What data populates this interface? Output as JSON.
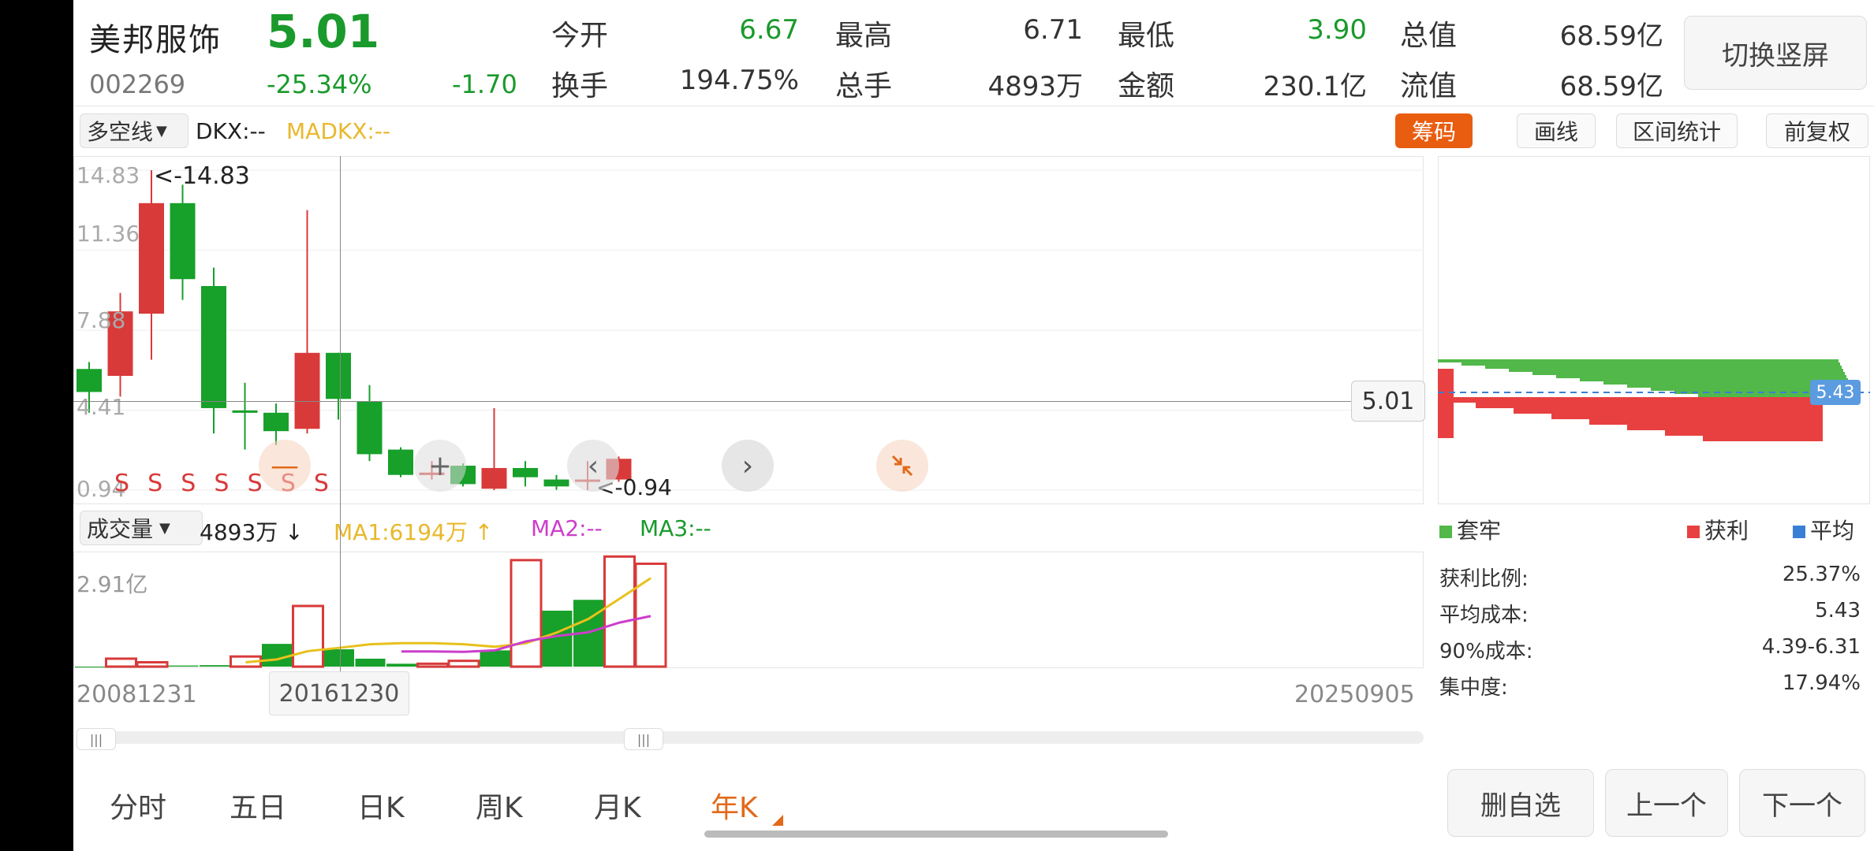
{
  "stock": {
    "name": "美邦服饰",
    "price": "5.01",
    "code": "002269",
    "change_pct": "-25.34%",
    "change": "-1.70"
  },
  "quote": [
    {
      "label": "今开",
      "value": "6.67",
      "color": "green"
    },
    {
      "label": "最高",
      "value": "6.71",
      "color": "dark"
    },
    {
      "label": "最低",
      "value": "3.90",
      "color": "green"
    },
    {
      "label": "总值",
      "value": "68.59亿",
      "color": "dark"
    },
    {
      "label": "换手",
      "value": "194.75%",
      "color": "dark"
    },
    {
      "label": "总手",
      "value": "4893万",
      "color": "dark"
    },
    {
      "label": "金额",
      "value": "230.1亿",
      "color": "dark"
    },
    {
      "label": "流值",
      "value": "68.59亿",
      "color": "dark"
    }
  ],
  "switch_screen_label": "切换竖屏",
  "toolbar": {
    "indicator_select": "多空线",
    "dkx": "DKX:--",
    "madkx": "MADKX:--",
    "buttons": [
      "筹码",
      "画线",
      "区间统计",
      "前复权"
    ],
    "active_button": "筹码"
  },
  "kline": {
    "y_labels": [
      "14.83",
      "11.36",
      "7.88",
      "4.41",
      "0.94"
    ],
    "max_marker": "<-14.83",
    "min_marker": "<-0.94",
    "current_price_tag": "5.01",
    "signal_marks": [
      "S",
      "S",
      "S",
      "S",
      "S",
      "S",
      "S"
    ],
    "ylim": [
      0.94,
      14.83
    ],
    "candles": [
      {
        "o": 5.2,
        "c": 6.2,
        "h": 6.5,
        "l": 4.3,
        "up": false
      },
      {
        "o": 5.9,
        "c": 8.7,
        "h": 9.5,
        "l": 5.0,
        "up": true
      },
      {
        "o": 8.6,
        "c": 13.4,
        "h": 14.83,
        "l": 6.6,
        "up": true
      },
      {
        "o": 13.4,
        "c": 10.1,
        "h": 14.2,
        "l": 9.2,
        "up": false
      },
      {
        "o": 9.8,
        "c": 4.5,
        "h": 10.6,
        "l": 3.4,
        "up": false
      },
      {
        "o": 4.4,
        "c": 4.4,
        "h": 5.6,
        "l": 2.7,
        "up": false
      },
      {
        "o": 4.3,
        "c": 3.5,
        "h": 4.7,
        "l": 2.9,
        "up": false
      },
      {
        "o": 3.6,
        "c": 6.9,
        "h": 13.1,
        "l": 3.4,
        "up": true
      },
      {
        "o": 6.9,
        "c": 4.9,
        "h": 6.9,
        "l": 4.0,
        "up": false
      },
      {
        "o": 4.8,
        "c": 2.5,
        "h": 5.5,
        "l": 2.2,
        "up": false
      },
      {
        "o": 2.7,
        "c": 1.6,
        "h": 2.8,
        "l": 1.5,
        "up": false
      },
      {
        "o": 1.7,
        "c": 1.7,
        "h": 2.2,
        "l": 1.4,
        "up": true
      },
      {
        "o": 2.0,
        "c": 1.2,
        "h": 2.1,
        "l": 1.1,
        "up": false
      },
      {
        "o": 1.0,
        "c": 1.9,
        "h": 4.5,
        "l": 0.94,
        "up": true
      },
      {
        "o": 1.9,
        "c": 1.5,
        "h": 2.2,
        "l": 1.1,
        "up": false
      },
      {
        "o": 1.4,
        "c": 1.1,
        "h": 1.6,
        "l": 0.95,
        "up": false
      },
      {
        "o": 1.4,
        "c": 1.4,
        "h": 2.2,
        "l": 0.94,
        "up": true
      },
      {
        "o": 1.4,
        "c": 2.3,
        "h": 2.4,
        "l": 1.3,
        "up": true
      }
    ]
  },
  "volume": {
    "select": "成交量",
    "value": "4893万",
    "ma1": "MA1:6194万",
    "ma2": "MA2:--",
    "ma3": "MA3:--",
    "y_label": "2.91亿",
    "ylim": [
      0,
      3.1
    ],
    "bars": [
      {
        "v": 0.0,
        "up": false
      },
      {
        "v": 0.22,
        "up": true
      },
      {
        "v": 0.12,
        "up": true
      },
      {
        "v": 0.03,
        "up": false
      },
      {
        "v": 0.04,
        "up": false
      },
      {
        "v": 0.28,
        "up": true
      },
      {
        "v": 0.63,
        "up": false
      },
      {
        "v": 1.68,
        "up": true
      },
      {
        "v": 0.48,
        "up": false
      },
      {
        "v": 0.22,
        "up": false
      },
      {
        "v": 0.08,
        "up": false
      },
      {
        "v": 0.08,
        "up": true
      },
      {
        "v": 0.16,
        "up": true
      },
      {
        "v": 0.45,
        "up": false
      },
      {
        "v": 2.95,
        "up": true
      },
      {
        "v": 1.55,
        "up": false
      },
      {
        "v": 1.85,
        "up": false
      },
      {
        "v": 3.05,
        "up": true
      },
      {
        "v": 2.85,
        "up": true
      }
    ],
    "ma1_line": [
      null,
      null,
      null,
      null,
      null,
      0.12,
      0.2,
      0.43,
      0.52,
      0.62,
      0.65,
      0.65,
      0.62,
      0.55,
      0.65,
      0.95,
      1.32,
      1.88,
      2.45
    ],
    "ma2_line": [
      null,
      null,
      null,
      null,
      null,
      null,
      null,
      null,
      null,
      null,
      0.42,
      0.42,
      0.41,
      0.45,
      0.7,
      0.85,
      0.95,
      1.22,
      1.4
    ]
  },
  "dates": {
    "start": "20081231",
    "cursor": "20161230",
    "end": "20250905"
  },
  "chips": {
    "avg_tag": "5.43",
    "legend": [
      {
        "label": "套牢",
        "color": "#52b84a"
      },
      {
        "label": "获利",
        "color": "#e84040"
      },
      {
        "label": "平均",
        "color": "#3a7fd6"
      }
    ],
    "stats": [
      {
        "label": "获利比例:",
        "value": "25.37%"
      },
      {
        "label": "平均成本:",
        "value": "5.43"
      },
      {
        "label": "90%成本:",
        "value": "4.39-6.31"
      },
      {
        "label": "集中度:",
        "value": "17.94%"
      }
    ]
  },
  "bottom_tabs": [
    "分时",
    "五日",
    "日K",
    "周K",
    "月K",
    "年K"
  ],
  "active_tab": "年K",
  "bottom_buttons": [
    "删自选",
    "上一个",
    "下一个"
  ]
}
